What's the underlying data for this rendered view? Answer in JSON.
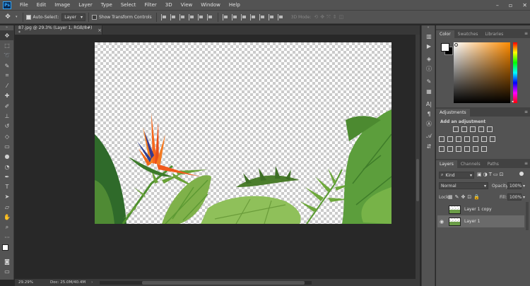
{
  "menubar": {
    "logo": "Ps",
    "items": [
      "File",
      "Edit",
      "Image",
      "Layer",
      "Type",
      "Select",
      "Filter",
      "3D",
      "View",
      "Window",
      "Help"
    ]
  },
  "options": {
    "auto_select_label": "Auto-Select:",
    "auto_select_value": "Layer",
    "show_transform_label": "Show Transform Controls",
    "mode_3d": "3D Mode:"
  },
  "document": {
    "tab_title": "87.jpg @ 29.3% (Layer 1, RGB/8#) *",
    "tab_close": "×",
    "zoom": "29.29%",
    "doc_size": "Doc: 25.0M/40.4M"
  },
  "color_panel": {
    "tabs": [
      "Color",
      "Swatches",
      "Libraries"
    ],
    "colors": {
      "foreground": "#ffffff",
      "background": "#000000",
      "picker_hue": "#ff8c00"
    }
  },
  "adjustments_panel": {
    "tabs": [
      "Adjustments"
    ],
    "heading": "Add an adjustment"
  },
  "layers_panel": {
    "tabs": [
      "Layers",
      "Channels",
      "Paths"
    ],
    "filter_kind": "Kind",
    "blend_mode": "Normal",
    "opacity_label": "Opacity:",
    "opacity_value": "100%",
    "lock_label": "Lock:",
    "fill_label": "Fill:",
    "fill_value": "100%",
    "layers": [
      {
        "name": "Layer 1 copy",
        "visible": false,
        "selected": false
      },
      {
        "name": "Layer 1",
        "visible": true,
        "selected": true
      }
    ]
  },
  "icons": {
    "tools": [
      "move-icon",
      "marquee-icon",
      "lasso-icon",
      "quick-select-icon",
      "crop-icon",
      "eyedropper-icon",
      "healing-icon",
      "brush-icon",
      "stamp-icon",
      "history-brush-icon",
      "eraser-icon",
      "gradient-icon",
      "blur-icon",
      "dodge-icon",
      "pen-icon",
      "type-icon",
      "path-select-icon",
      "shape-icon",
      "hand-icon",
      "zoom-icon",
      "more-icon"
    ]
  }
}
